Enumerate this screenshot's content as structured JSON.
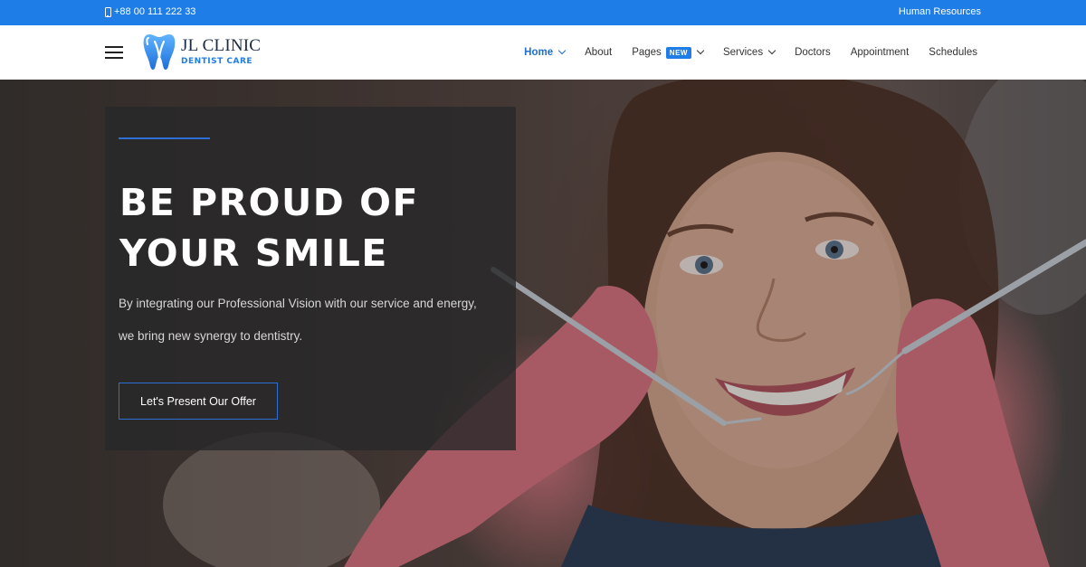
{
  "topbar": {
    "phone": "+88 00 111 222 33",
    "right_link": "Human Resources"
  },
  "logo": {
    "title": "JL CLINIC",
    "subtitle": "DENTIST CARE"
  },
  "nav": {
    "items": [
      {
        "label": "Home",
        "has_dropdown": true,
        "active": true
      },
      {
        "label": "About"
      },
      {
        "label": "Pages",
        "badge": "NEW",
        "has_dropdown": true
      },
      {
        "label": "Services",
        "has_dropdown": true
      },
      {
        "label": "Doctors"
      },
      {
        "label": "Appointment"
      },
      {
        "label": "Schedules"
      }
    ]
  },
  "hero": {
    "title_line1": "BE PROUD OF",
    "title_line2": "YOUR SMILE",
    "text_line1": "By integrating our Professional Vision with our service and energy,",
    "text_line2": "we bring new synergy to dentistry.",
    "button_label": "Let's Present Our Offer"
  },
  "colors": {
    "accent": "#1e7de6",
    "dark_box": "#28282a"
  }
}
